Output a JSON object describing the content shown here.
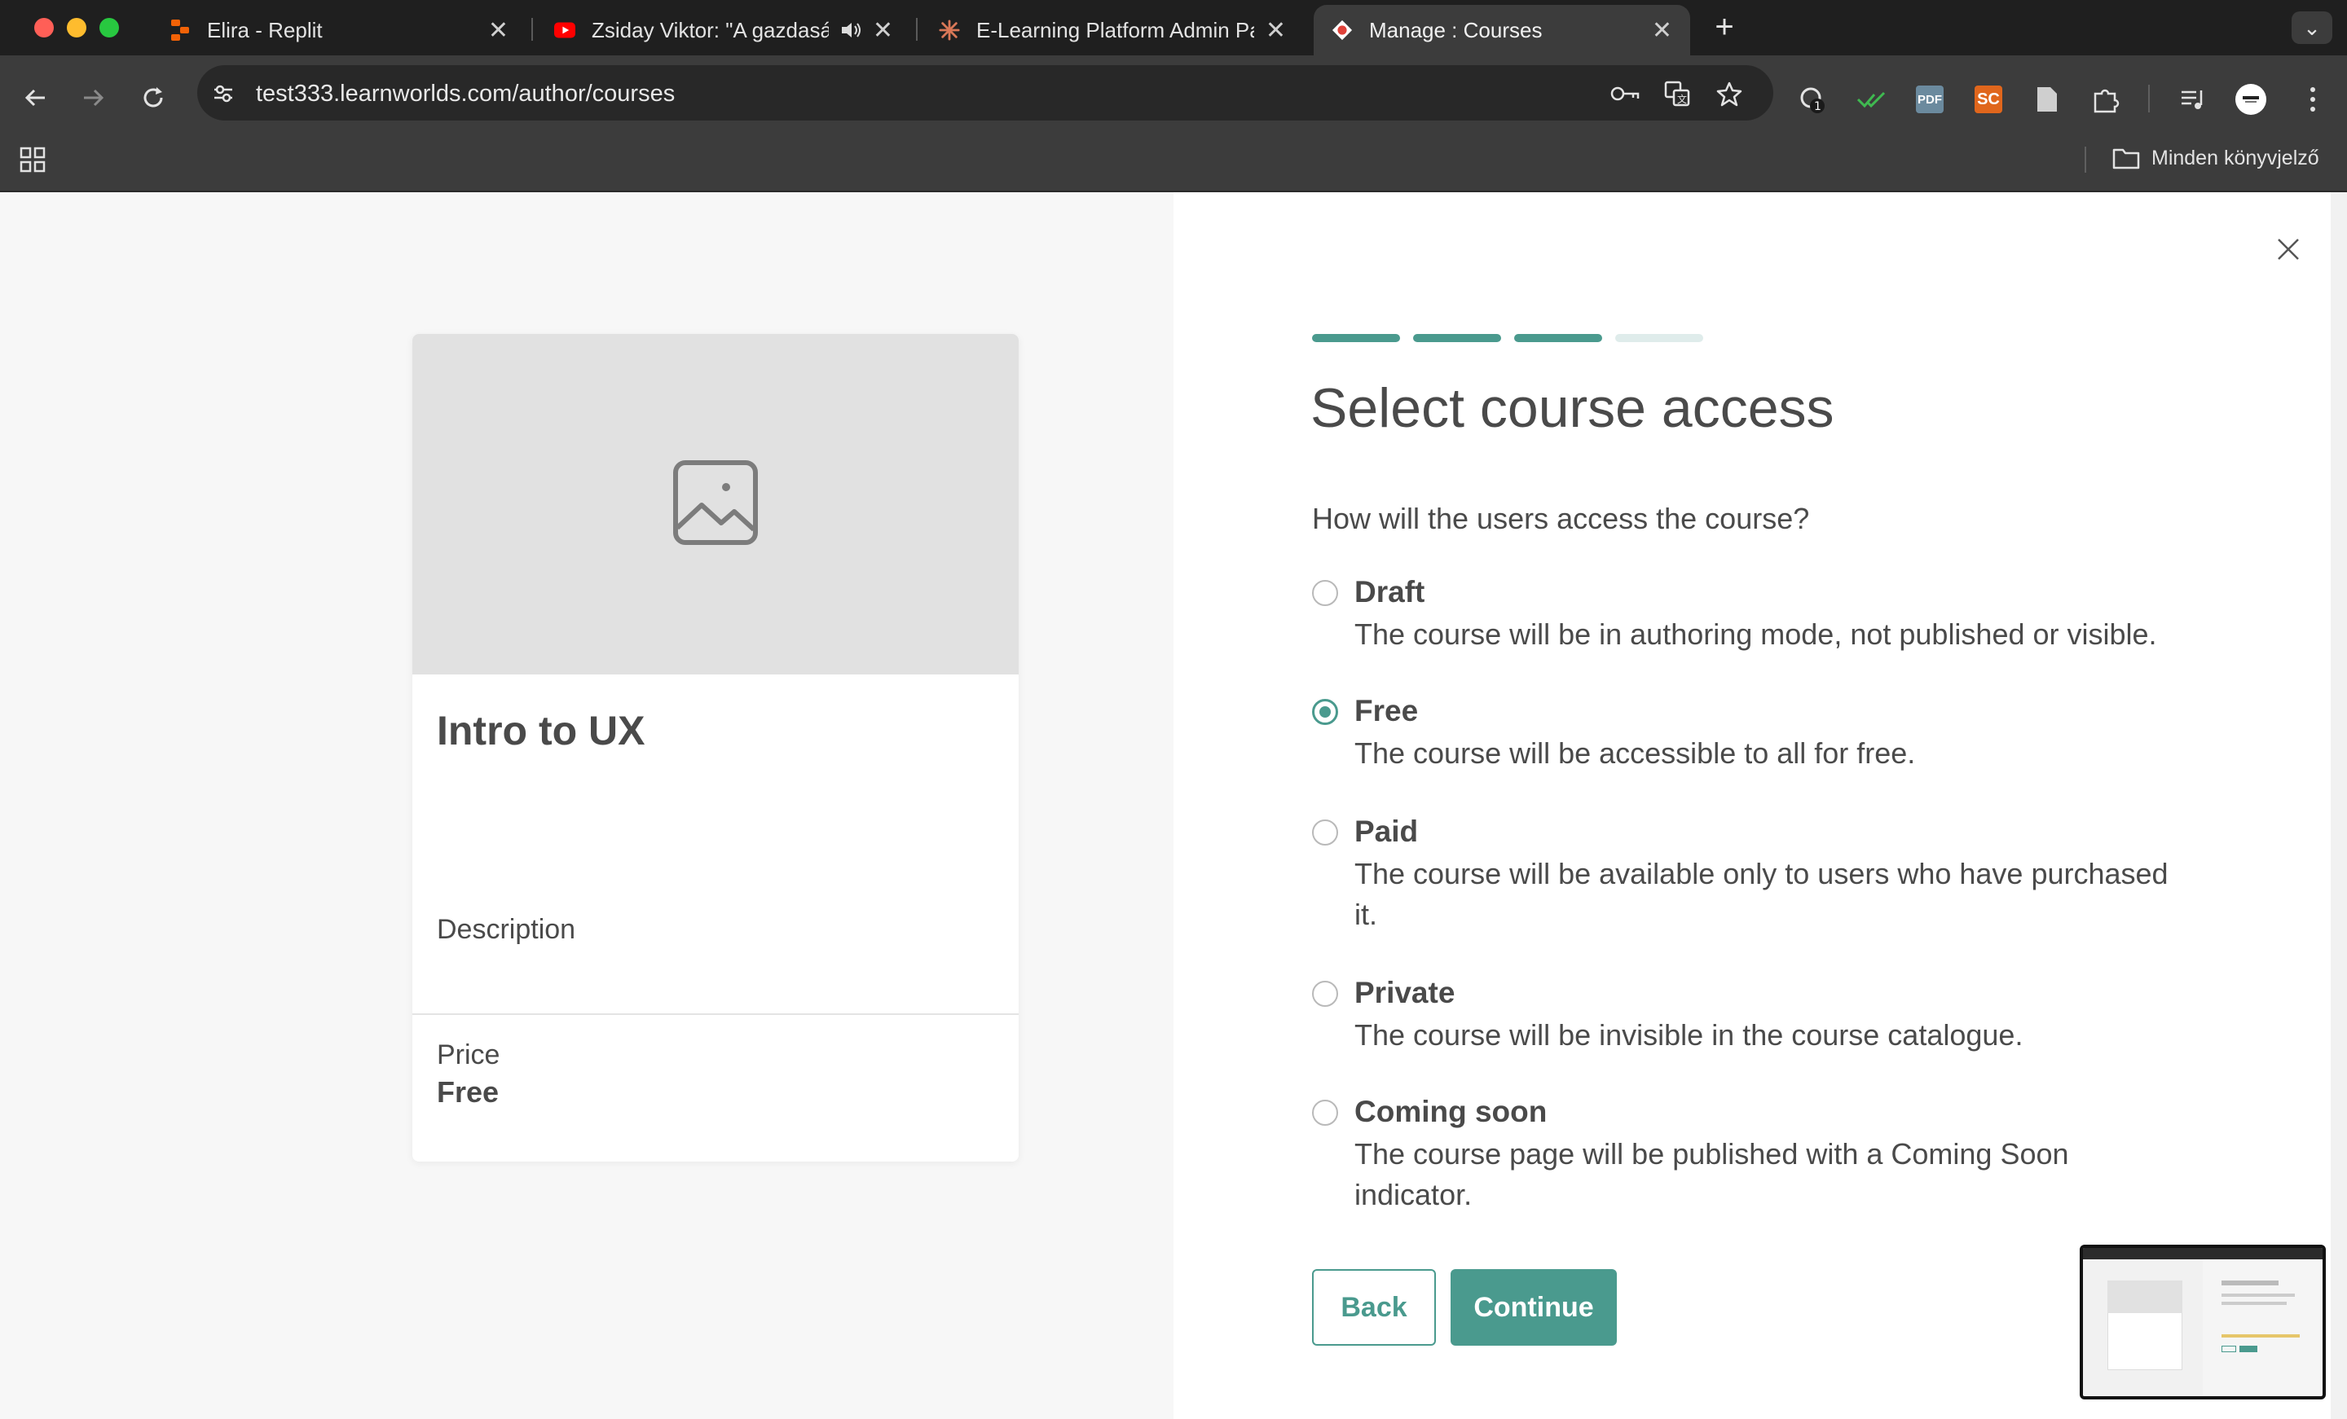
{
  "browser": {
    "tabs": [
      {
        "title": "Elira - Replit",
        "favicon": "replit-icon"
      },
      {
        "title": "Zsiday Viktor: \"A gazdasá",
        "favicon": "youtube-icon",
        "audio": "speaker-icon"
      },
      {
        "title": "E-Learning Platform Admin Pa",
        "favicon": "sparkle-icon"
      },
      {
        "title": "Manage : Courses",
        "favicon": "learnworlds-icon"
      }
    ],
    "url": "test333.learnworlds.com/author/courses",
    "all_bookmarks": "Minden könyvjelző",
    "extensions": [
      "pdf-icon",
      "sc-icon"
    ],
    "extension_labels": {
      "pdf": "PDF",
      "sc": "SC"
    },
    "badge_count": "1"
  },
  "preview_card": {
    "image_icon": "image-placeholder-icon",
    "title": "Intro to UX",
    "description": "Description",
    "price_label": "Price",
    "price_value": "Free"
  },
  "wizard": {
    "steps_total": 4,
    "steps_completed": 3,
    "heading": "Select course access",
    "question": "How will the users access the course?",
    "selected": "Free",
    "options": [
      {
        "title": "Draft",
        "description": "The course will be in authoring mode, not published or visible."
      },
      {
        "title": "Free",
        "description": "The course will be accessible to all for free."
      },
      {
        "title": "Paid",
        "description": "The course will be available only to users who have purchased it."
      },
      {
        "title": "Private",
        "description": "The course will be invisible in the course catalogue."
      },
      {
        "title": "Coming soon",
        "description": "The course page will be published with a Coming Soon indicator."
      }
    ],
    "back_label": "Back",
    "continue_label": "Continue"
  },
  "colors": {
    "accent": "#4a9a8e",
    "step_inactive": "#dfeceb",
    "text": "#4a4a4a"
  }
}
